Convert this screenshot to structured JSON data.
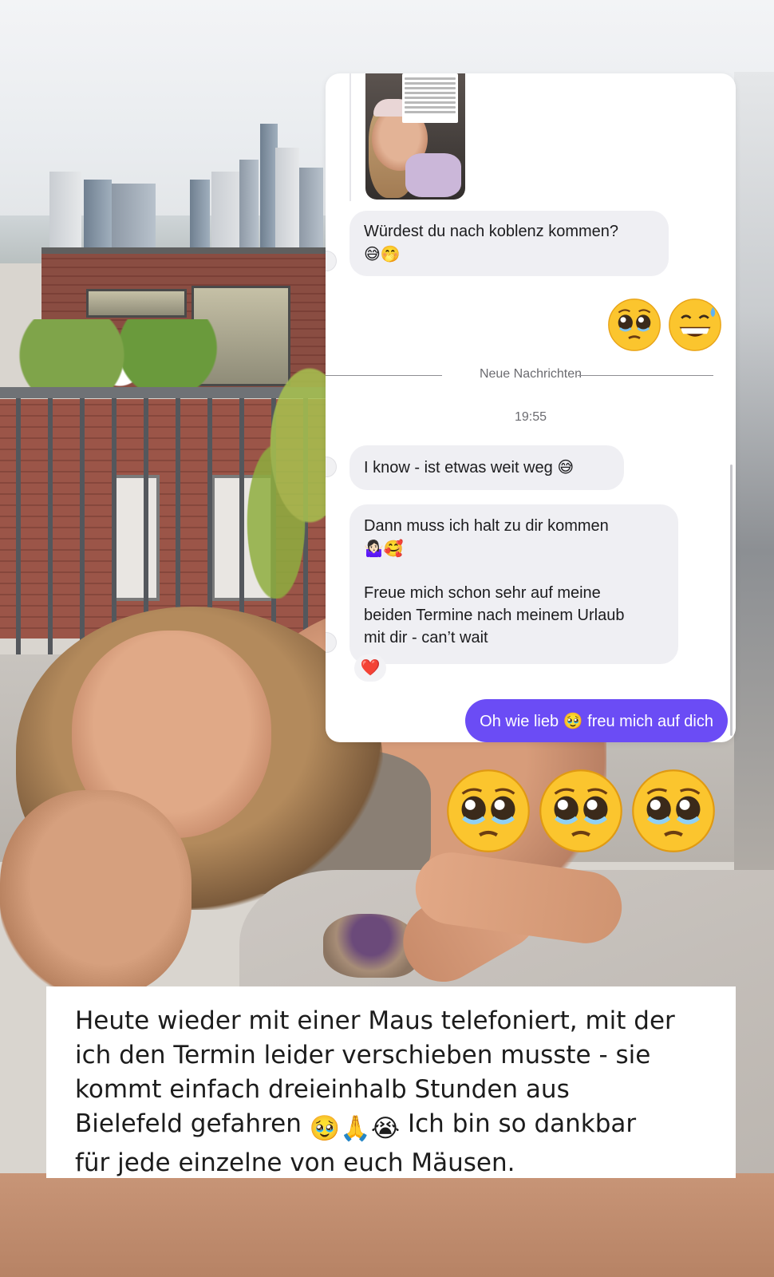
{
  "chat": {
    "story_caption_lines": 8,
    "messages": [
      {
        "id": "m1",
        "side": "received",
        "text": "Würdest du nach koblenz kommen?",
        "emojis": "😅🤭"
      },
      {
        "id": "m2",
        "side": "sent",
        "emojis": "🥹😅"
      },
      {
        "id": "m3",
        "side": "received",
        "text": "I know - ist etwas weit weg",
        "emojis": "😅"
      },
      {
        "id": "m4",
        "side": "received",
        "line1": "Dann muss ich halt zu dir kommen",
        "line1_emojis": "🤷🏻‍♀️🥰",
        "line2": "Freue mich schon sehr auf meine",
        "line3": "beiden Termine nach meinem Urlaub",
        "line4": "mit dir - can’t wait"
      },
      {
        "id": "m5",
        "side": "sent",
        "text_before": "Oh wie lieb",
        "emoji": "🥹",
        "text_after": "freu mich auf dich"
      }
    ],
    "divider_label": "Neue Nachrichten",
    "timestamp": "19:55",
    "reaction": "❤️"
  },
  "overlay_emojis": [
    "pleading-face",
    "pleading-face",
    "pleading-face"
  ],
  "caption": {
    "line1": "Heute wieder mit einer Maus telefoniert, mit der",
    "line2": "ich den Termin leider verschieben musste - sie",
    "line3": "kommt einfach dreieinhalb Stunden aus",
    "line4_text": "Bielefeld gefahren",
    "line4_emojis": "🥹🙏😭",
    "line4_after": "Ich bin so dankbar",
    "line5": "für jede einzelne von euch Mäusen."
  },
  "colors": {
    "sent_bubble": "#6b4cf5",
    "received_bubble": "#efeff3",
    "heart": "#e02a3a"
  }
}
